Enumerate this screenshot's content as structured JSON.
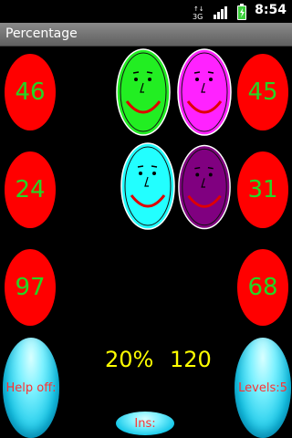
{
  "status": {
    "time": "8:54",
    "net_label": "3G"
  },
  "app": {
    "title": "Percentage"
  },
  "numbers": {
    "left": [
      "46",
      "24",
      "97"
    ],
    "right": [
      "45",
      "31",
      "68"
    ]
  },
  "faces": [
    {
      "name": "green-face",
      "color": "#22ee22"
    },
    {
      "name": "magenta-face",
      "color": "#ff22ff"
    },
    {
      "name": "cyan-face",
      "color": "#22ffff"
    },
    {
      "name": "purple-face",
      "color": "#800080"
    }
  ],
  "info": {
    "percent": "20%",
    "score": "120"
  },
  "buttons": {
    "help": "Help off:",
    "levels": "Levels:5",
    "ins": "Ins:"
  },
  "colors": {
    "number_oval": "#ff0000",
    "number_text": "#24d624",
    "info_text": "#ffff00",
    "button_text": "#ff3030"
  }
}
